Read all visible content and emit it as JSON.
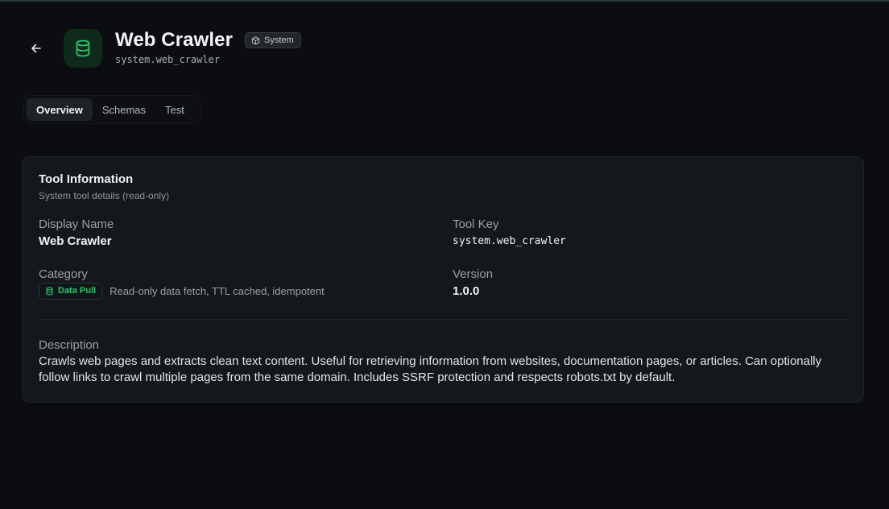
{
  "header": {
    "title": "Web Crawler",
    "system_badge": "System",
    "tool_key": "system.web_crawler",
    "back_icon": "arrow-left-icon",
    "tool_icon": "database-icon",
    "tool_icon_color": "#2ec36a"
  },
  "tabs": [
    {
      "label": "Overview",
      "active": true
    },
    {
      "label": "Schemas",
      "active": false
    },
    {
      "label": "Test",
      "active": false
    }
  ],
  "card": {
    "title": "Tool Information",
    "subtitle": "System tool details (read-only)",
    "display_name": {
      "label": "Display Name",
      "value": "Web Crawler"
    },
    "tool_key": {
      "label": "Tool Key",
      "value": "system.web_crawler"
    },
    "category": {
      "label": "Category",
      "badge": "Data Pull",
      "badge_color": "#2ec36a",
      "description": "Read-only data fetch, TTL cached, idempotent"
    },
    "version": {
      "label": "Version",
      "value": "1.0.0"
    },
    "description": {
      "label": "Description",
      "value": "Crawls web pages and extracts clean text content. Useful for retrieving information from websites, documentation pages, or articles. Can optionally follow links to crawl multiple pages from the same domain. Includes SSRF protection and respects robots.txt by default."
    }
  }
}
